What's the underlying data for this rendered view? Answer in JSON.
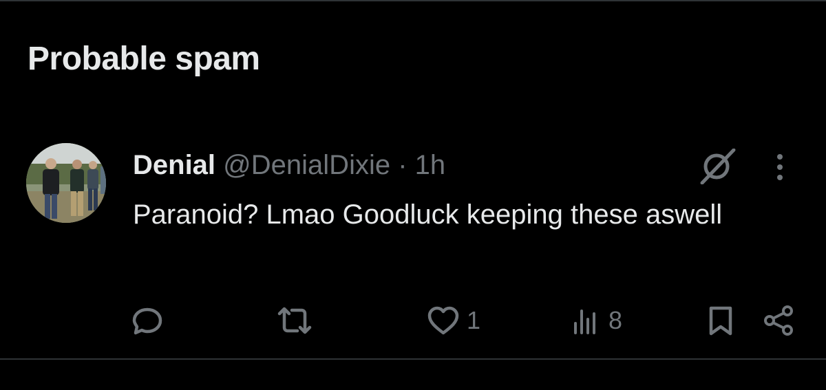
{
  "section": {
    "title": "Probable spam"
  },
  "tweet": {
    "author_name": "Denial",
    "handle": "@DenialDixie",
    "separator": "·",
    "time": "1h",
    "text": "Paranoid? Lmao Goodluck keeping these aswell",
    "actions": {
      "reply_count": "",
      "retweet_count": "",
      "like_count": "1",
      "views_count": "8"
    }
  },
  "icons": {
    "reply": "reply-icon",
    "retweet": "retweet-icon",
    "like": "heart-icon",
    "views": "views-chart-icon",
    "bookmark": "bookmark-icon",
    "share": "share-icon",
    "grok": "grok-icon",
    "more": "more-vertical-icon"
  },
  "colors": {
    "background": "#000000",
    "text_primary": "#e7e9ea",
    "text_secondary": "#71767b",
    "divider": "#2f3336"
  }
}
